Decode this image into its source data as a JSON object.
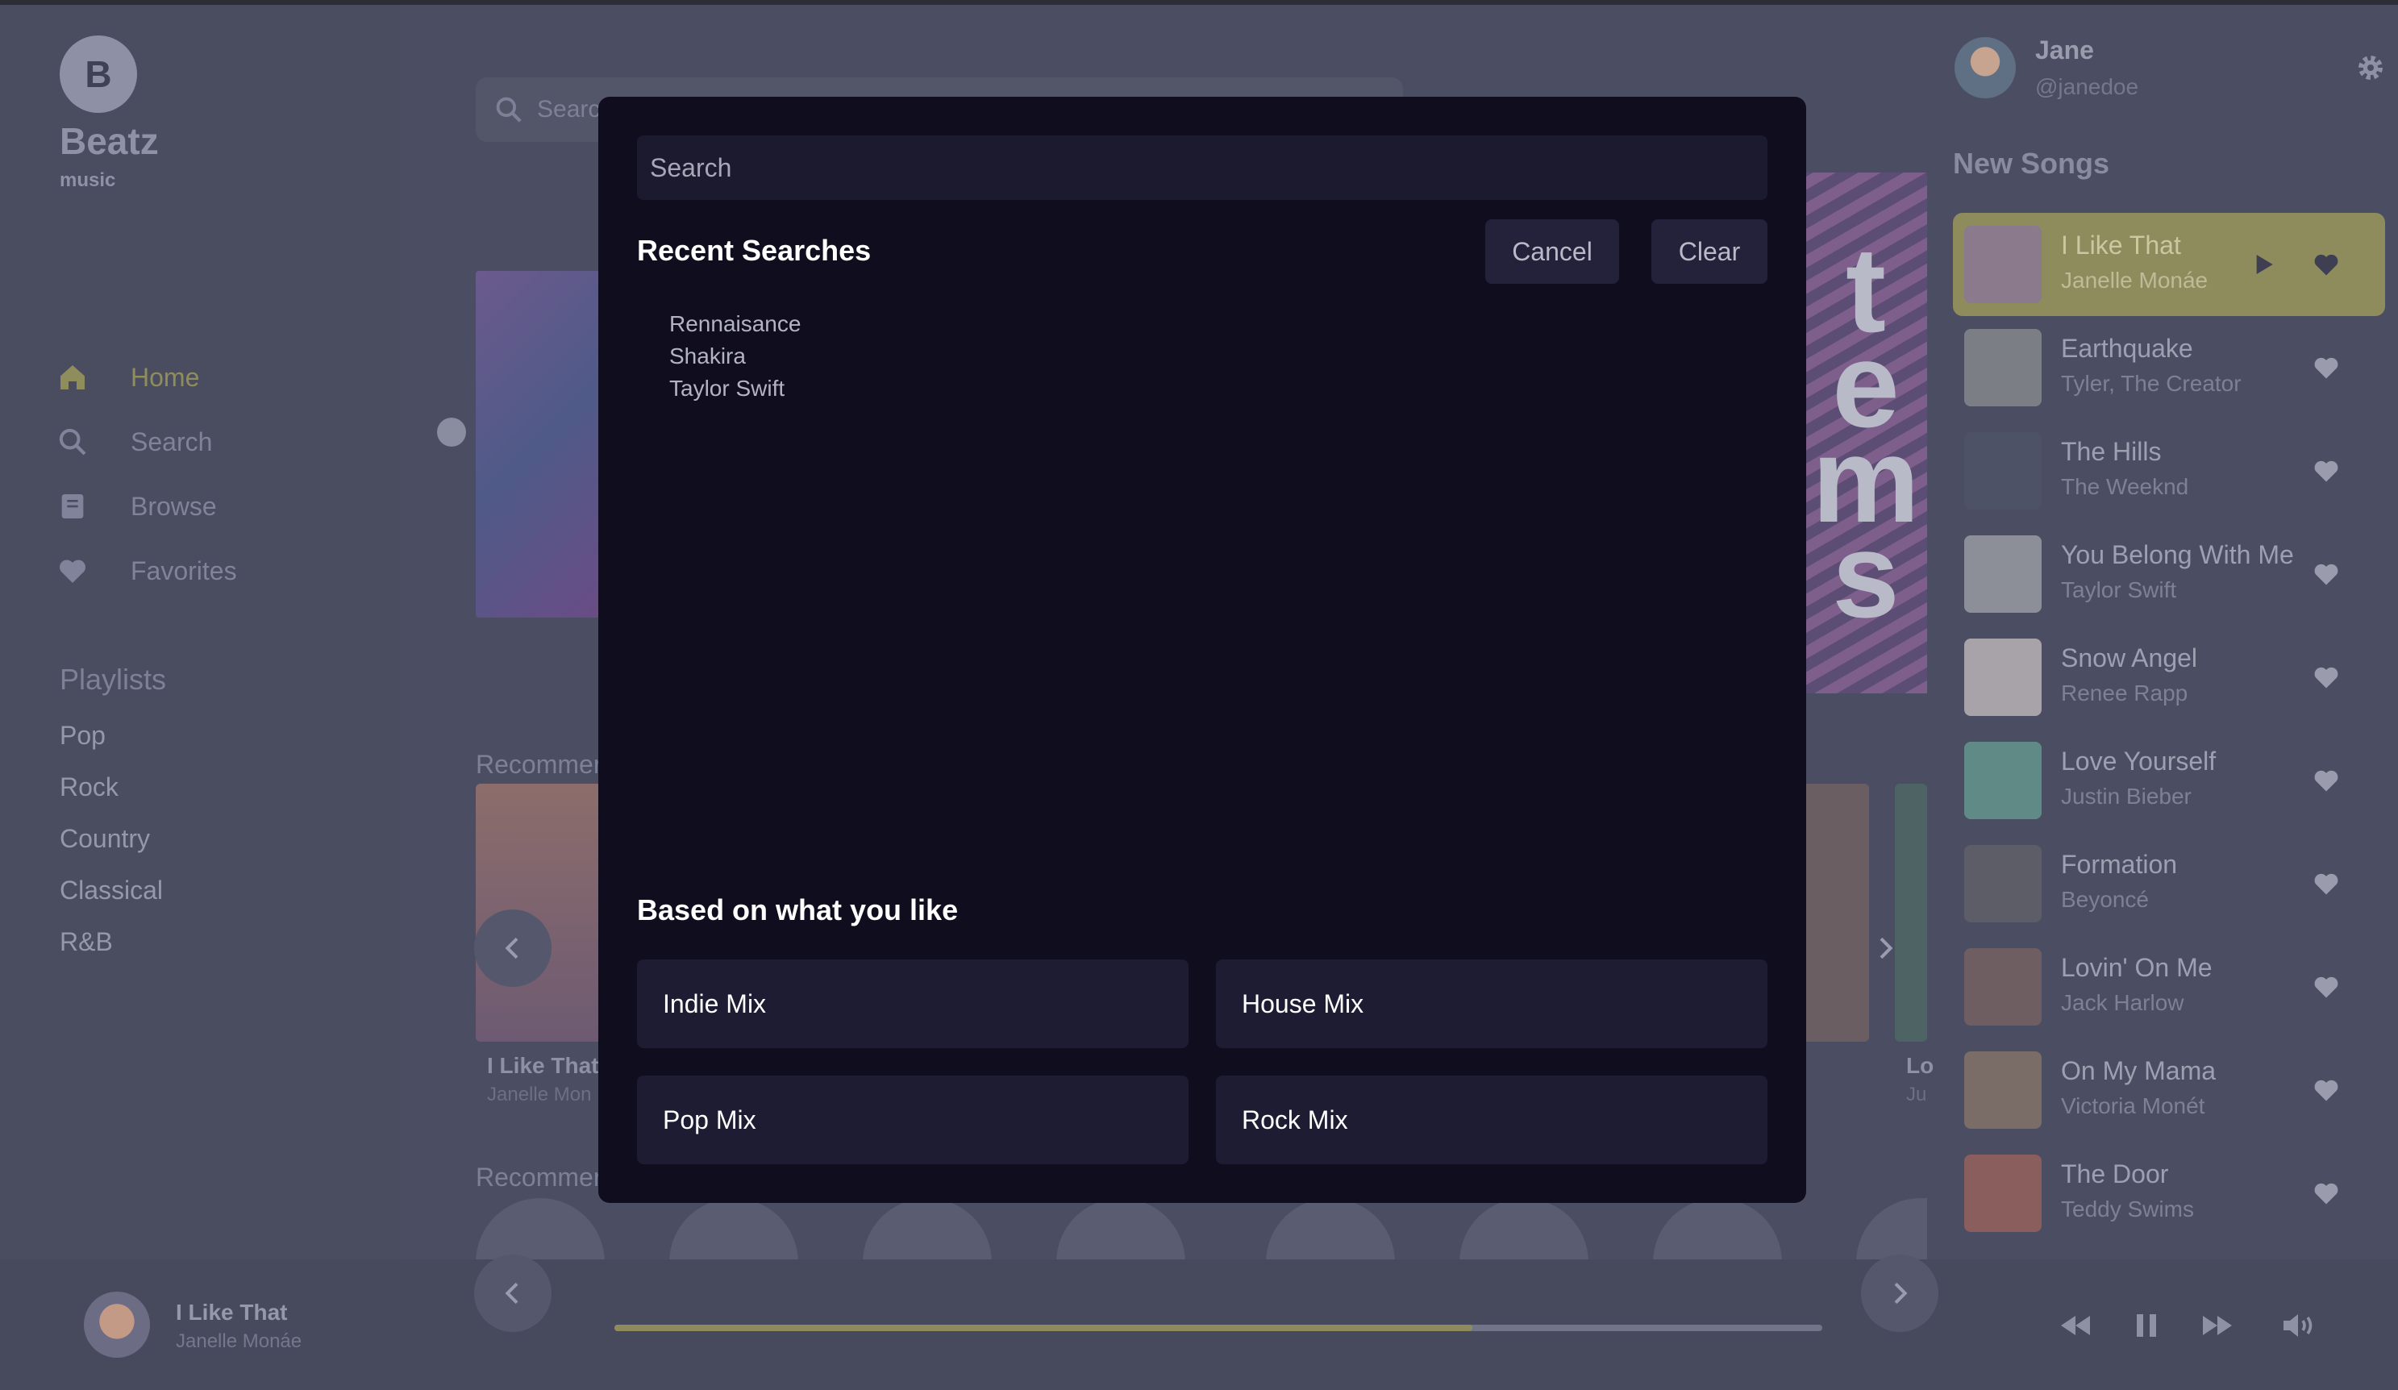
{
  "brand": {
    "badge": "B",
    "name": "Beatz",
    "sub": "music"
  },
  "nav": {
    "home": "Home",
    "search": "Search",
    "browse": "Browse",
    "favorites": "Favorites"
  },
  "playlists": {
    "title": "Playlists",
    "items": [
      "Pop",
      "Rock",
      "Country",
      "Classical",
      "R&B"
    ]
  },
  "main": {
    "search_placeholder": "Searc",
    "hero_letters": "t e m s",
    "section1": "Recommer",
    "section2": "Recommer",
    "rec_first_title": "I Like That",
    "rec_first_artist": "Janelle Mon",
    "rec_last_title": "Lo",
    "rec_last_artist": "Ju"
  },
  "user": {
    "name": "Jane",
    "handle": "@janedoe"
  },
  "new_songs": {
    "title": "New Songs",
    "items": [
      {
        "title": "I Like That",
        "artist": "Janelle Monáe"
      },
      {
        "title": "Earthquake",
        "artist": "Tyler, The Creator"
      },
      {
        "title": "The Hills",
        "artist": "The Weeknd"
      },
      {
        "title": "You Belong With Me",
        "artist": "Taylor Swift"
      },
      {
        "title": "Snow Angel",
        "artist": "Renee Rapp"
      },
      {
        "title": "Love Yourself",
        "artist": "Justin Bieber"
      },
      {
        "title": "Formation",
        "artist": "Beyoncé"
      },
      {
        "title": "Lovin' On Me",
        "artist": "Jack Harlow"
      },
      {
        "title": "On My Mama",
        "artist": "Victoria Monét"
      },
      {
        "title": "The Door",
        "artist": "Teddy Swims"
      }
    ]
  },
  "player": {
    "title": "I Like That",
    "artist": "Janelle Monáe",
    "progress": 0.71
  },
  "modal": {
    "search_placeholder": "Search",
    "recent_title": "Recent Searches",
    "cancel": "Cancel",
    "clear": "Clear",
    "recent": [
      "Rennaisance",
      "Shakira",
      "Taylor Swift"
    ],
    "based_title": "Based on what you like",
    "mixes": [
      "Indie Mix",
      "House Mix",
      "Pop Mix",
      "Rock Mix"
    ]
  },
  "colors": {
    "accent": "#8e8c5d",
    "modal_bg": "#100e1e",
    "page_bg": "#4b4e63"
  }
}
